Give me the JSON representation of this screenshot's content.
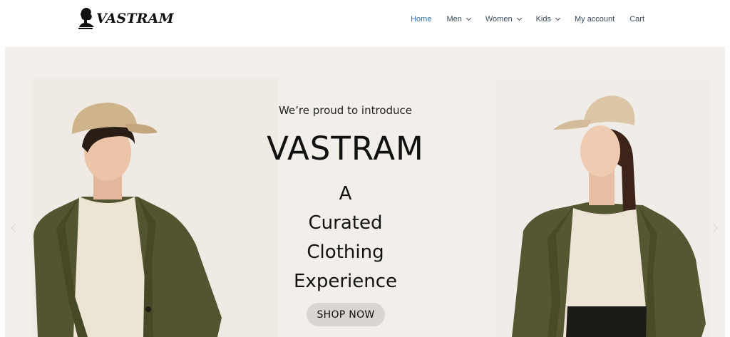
{
  "header": {
    "logo_text": "VASTRAM",
    "nav": [
      {
        "label": "Home",
        "active": true,
        "has_dropdown": false
      },
      {
        "label": "Men",
        "active": false,
        "has_dropdown": true
      },
      {
        "label": "Women",
        "active": false,
        "has_dropdown": true
      },
      {
        "label": "Kids",
        "active": false,
        "has_dropdown": true
      },
      {
        "label": "My account",
        "active": false,
        "has_dropdown": false
      },
      {
        "label": "Cart",
        "active": false,
        "has_dropdown": false
      }
    ]
  },
  "hero": {
    "intro": "We’re proud to introduce",
    "brand": "VASTRAM",
    "tagline_lines": [
      "A",
      "Curated",
      "Clothing",
      "Experience"
    ],
    "cta_label": "SHOP NOW",
    "prev_icon": "chevron-left-icon",
    "next_icon": "chevron-right-icon"
  },
  "colors": {
    "nav_active": "#2f6fb0",
    "nav_text": "#3a4a5a",
    "hero_bg": "#f2efea",
    "button_bg": "#d9d6d2"
  }
}
